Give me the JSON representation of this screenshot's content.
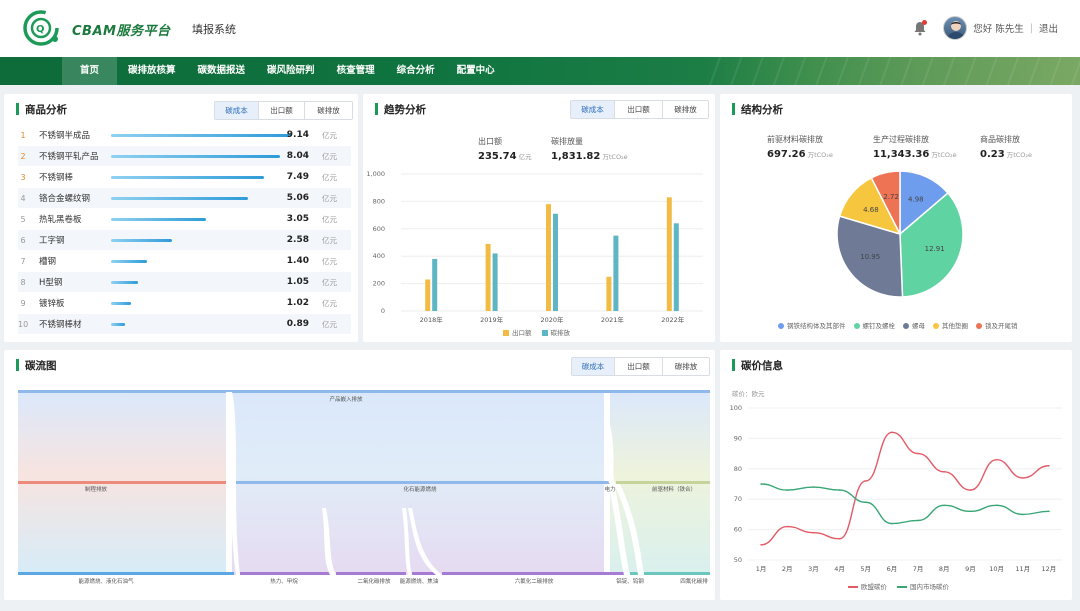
{
  "header": {
    "brand": "CBAM服务平台",
    "subsystem": "填报系统",
    "greeting": "您好 陈先生",
    "separator": "|",
    "logout": "退出"
  },
  "nav": {
    "items": [
      "首页",
      "碳排放核算",
      "碳数据报送",
      "碳风险研判",
      "核查管理",
      "综合分析",
      "配置中心"
    ]
  },
  "product": {
    "title": "商品分析",
    "tabs": [
      "碳成本",
      "出口额",
      "碳排放"
    ],
    "rows": [
      {
        "rank": "1",
        "name": "不锈钢半成品",
        "value": "9.14",
        "unit": "亿元",
        "ratio": 1.0
      },
      {
        "rank": "2",
        "name": "不锈钢平轧产品",
        "value": "8.04",
        "unit": "亿元",
        "ratio": 0.94
      },
      {
        "rank": "3",
        "name": "不锈钢棒",
        "value": "7.49",
        "unit": "亿元",
        "ratio": 0.85
      },
      {
        "rank": "4",
        "name": "铬合金螺纹钢",
        "value": "5.06",
        "unit": "亿元",
        "ratio": 0.76
      },
      {
        "rank": "5",
        "name": "热轧黑卷板",
        "value": "3.05",
        "unit": "亿元",
        "ratio": 0.53
      },
      {
        "rank": "6",
        "name": "工字钢",
        "value": "2.58",
        "unit": "亿元",
        "ratio": 0.34
      },
      {
        "rank": "7",
        "name": "槽钢",
        "value": "1.40",
        "unit": "亿元",
        "ratio": 0.2
      },
      {
        "rank": "8",
        "name": "H型钢",
        "value": "1.05",
        "unit": "亿元",
        "ratio": 0.15
      },
      {
        "rank": "9",
        "name": "镀锌板",
        "value": "1.02",
        "unit": "亿元",
        "ratio": 0.11
      },
      {
        "rank": "10",
        "name": "不锈钢棒材",
        "value": "0.89",
        "unit": "亿元",
        "ratio": 0.08
      }
    ]
  },
  "trend": {
    "title": "趋势分析",
    "tabs": [
      "碳成本",
      "出口额",
      "碳排放"
    ],
    "kpi": [
      {
        "label": "出口额",
        "value": "235.74",
        "unit": "亿元"
      },
      {
        "label": "碳排放量",
        "value": "1,831.82",
        "unit": "万tCO₂e"
      }
    ],
    "chart_data": {
      "type": "bar",
      "categories": [
        "2018年",
        "2019年",
        "2020年",
        "2021年",
        "2022年"
      ],
      "series": [
        {
          "name": "出口额",
          "color": "#f2bc44",
          "values": [
            230,
            490,
            780,
            250,
            830
          ]
        },
        {
          "name": "碳排放",
          "color": "#5eb5c4",
          "values": [
            380,
            420,
            710,
            550,
            640
          ]
        }
      ],
      "ylim": [
        0,
        1000
      ],
      "yticks": [
        "0",
        "200",
        "400",
        "600",
        "800",
        "1,000"
      ]
    }
  },
  "structure": {
    "title": "结构分析",
    "kpi": [
      {
        "label": "前驱材料碳排放",
        "value": "697.26",
        "unit": "万tCO₂e"
      },
      {
        "label": "生产过程碳排放",
        "value": "11,343.36",
        "unit": "万tCO₂e"
      },
      {
        "label": "商品碳排放",
        "value": "0.23",
        "unit": "万tCO₂e"
      }
    ],
    "chart_data": {
      "type": "pie",
      "slices": [
        {
          "name": "钢铁结构体及其部件",
          "value": 4.98,
          "color": "#6f9ded"
        },
        {
          "name": "螺钉及螺栓",
          "value": 12.91,
          "color": "#5fd3a1"
        },
        {
          "name": "螺母",
          "value": 10.95,
          "color": "#6e7a96"
        },
        {
          "name": "其他垫圈",
          "value": 4.68,
          "color": "#f6c63f"
        },
        {
          "name": "锁及开尾销",
          "value": 2.72,
          "color": "#ee7355"
        }
      ]
    }
  },
  "sankey": {
    "title": "碳流图",
    "tabs": [
      "碳成本",
      "出口额",
      "碳排放"
    ],
    "labels": {
      "top": "产品嵌入排放",
      "mid1": "制程排放",
      "mid2": "化石能源燃烧",
      "mid3": "电力",
      "mid4": "前驱材料（铁合）",
      "b1": "能源燃烧、液化石油气",
      "b2": "热力、甲烷",
      "b3": "二氧化碳排放",
      "b4": "能源燃烧、焦油",
      "b5": "六氟化二碳排放",
      "b6": "铝锭、钨钢",
      "b7": "四氟化碳排"
    }
  },
  "price": {
    "title": "碳价信息",
    "unit_label": "碳价：欧元",
    "chart_data": {
      "type": "line",
      "categories": [
        "1月",
        "2月",
        "3月",
        "4月",
        "5月",
        "6月",
        "7月",
        "8月",
        "9月",
        "10月",
        "11月",
        "12月"
      ],
      "ylim": [
        50,
        100
      ],
      "yticks": [
        "50",
        "60",
        "70",
        "80",
        "90",
        "100"
      ],
      "series": [
        {
          "name": "欧盟碳价",
          "color": "#e35a67",
          "values": [
            55,
            61,
            59,
            57,
            76,
            92,
            85,
            79,
            73,
            83,
            77,
            81
          ]
        },
        {
          "name": "国内市场碳价",
          "color": "#3aa676",
          "values": [
            75,
            73,
            74,
            73,
            69,
            62,
            63,
            68,
            66,
            68,
            65,
            66
          ]
        }
      ]
    }
  }
}
